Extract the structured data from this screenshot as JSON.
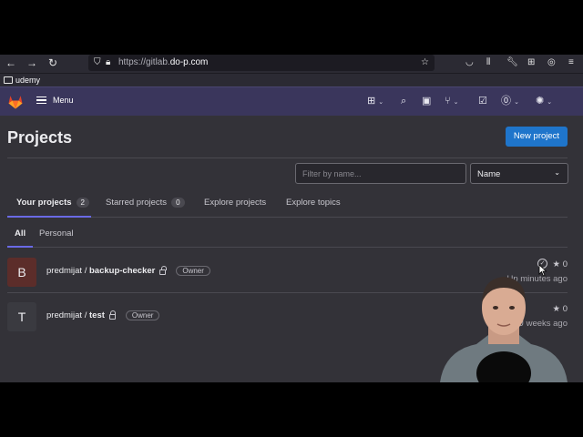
{
  "browser": {
    "url_prefix": "https://gitlab.",
    "url_domain": "do-p.com",
    "bookmark_folder": "udemy"
  },
  "header": {
    "menu_label": "Menu"
  },
  "page": {
    "title": "Projects",
    "new_project_label": "New project",
    "filter_placeholder": "Filter by name...",
    "sort_value": "Name",
    "tabs": [
      {
        "label": "Your projects",
        "count": "2"
      },
      {
        "label": "Starred projects",
        "count": "0"
      },
      {
        "label": "Explore projects"
      },
      {
        "label": "Explore topics"
      }
    ],
    "subtabs": [
      "All",
      "Personal"
    ]
  },
  "projects": [
    {
      "avatar_letter": "B",
      "namespace": "predmijat / ",
      "name": "backup-checker",
      "role": "Owner",
      "stars": "★ 0",
      "updated": "Updated 15 minutes ago",
      "visible_updated": "Up      minutes ago",
      "avatar_color": "#5c2d2a"
    },
    {
      "avatar_letter": "T",
      "namespace": "predmijat / ",
      "name": "test",
      "role": "Owner",
      "stars": "★ 0",
      "updated": "Updated 2 weeks ago",
      "visible_updated": "U      weeks ago",
      "avatar_color": "#3a3a40"
    }
  ],
  "colors": {
    "header_bg": "#3a365c",
    "primary": "#1f75cb",
    "page_bg": "#333238",
    "active_tab": "#6a6ae6"
  }
}
